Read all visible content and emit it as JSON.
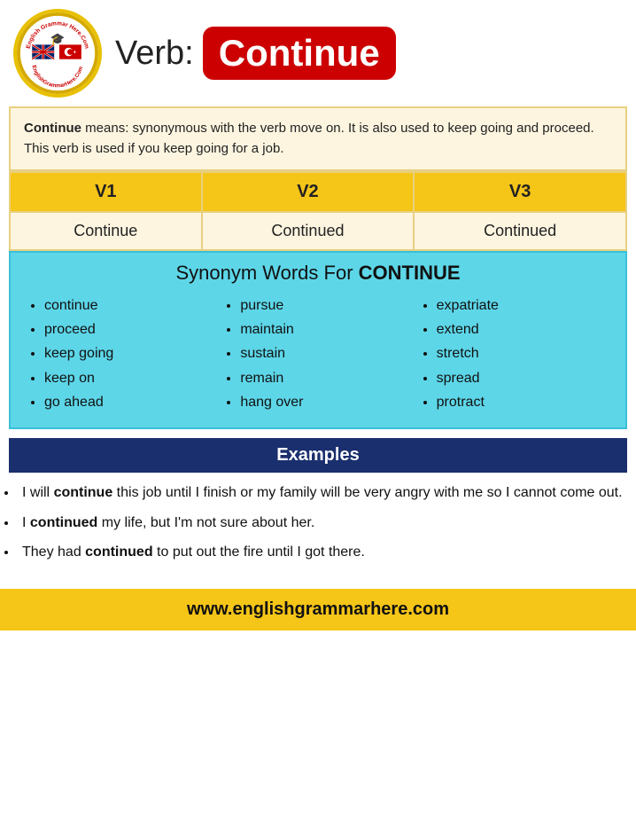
{
  "header": {
    "verb_label": "Verb:",
    "verb_name": "Continue",
    "logo_alt": "English Grammar Here"
  },
  "definition": {
    "text_bold": "Continue",
    "text_rest": " means: synonymous with the verb move on. It is also used to keep going and proceed. This verb is used if you keep going for a job."
  },
  "verb_forms": {
    "headers": [
      "V1",
      "V2",
      "V3"
    ],
    "values": [
      "Continue",
      "Continued",
      "Continued"
    ]
  },
  "synonyms": {
    "title_normal": "Synonym Words For ",
    "title_bold": "CONTINUE",
    "columns": [
      [
        "continue",
        "proceed",
        "keep going",
        "keep on",
        "go ahead"
      ],
      [
        "pursue",
        "maintain",
        "sustain",
        "remain",
        "hang over"
      ],
      [
        "expatriate",
        "extend",
        "stretch",
        "spread",
        "protract"
      ]
    ]
  },
  "examples_header": "Examples",
  "examples": [
    {
      "before": "I will ",
      "bold": "continue",
      "after": " this job until I finish or my family will be very angry with me so I cannot come out."
    },
    {
      "before": "I ",
      "bold": "continued",
      "after": " my life, but I'm not sure about her."
    },
    {
      "before": "They had ",
      "bold": "continued",
      "after": " to put out the fire until I got there."
    }
  ],
  "footer": {
    "url": "www.englishgrammarhere.com"
  }
}
